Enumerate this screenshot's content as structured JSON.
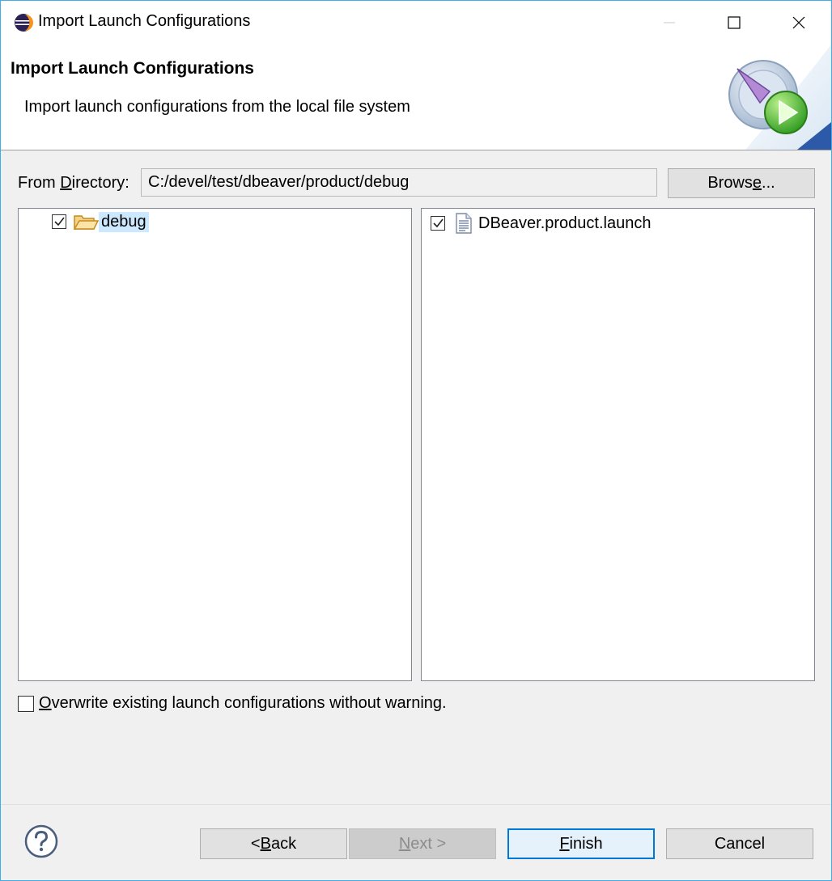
{
  "window": {
    "title": "Import Launch Configurations",
    "icon": "eclipse-icon"
  },
  "banner": {
    "title": "Import Launch Configurations",
    "description": "Import launch configurations from the local file system",
    "graphic": "wizard-launch-graphic"
  },
  "directory": {
    "label_pre": "From ",
    "label_mnemonic": "D",
    "label_post": "irectory:",
    "value": "C:/devel/test/dbeaver/product/debug",
    "browse_pre": "Brows",
    "browse_mnemonic": "e",
    "browse_post": "..."
  },
  "left_tree": {
    "items": [
      {
        "label": "debug",
        "checked": true,
        "icon": "open-folder-icon",
        "selected": true
      }
    ]
  },
  "right_list": {
    "items": [
      {
        "label": "DBeaver.product.launch",
        "checked": true,
        "icon": "launch-file-icon"
      }
    ]
  },
  "overwrite": {
    "mnemonic": "O",
    "label_rest": "verwrite existing launch configurations without warning.",
    "checked": false
  },
  "footer": {
    "back_pre": "< ",
    "back_mnemonic": "B",
    "back_post": "ack",
    "next_mnemonic": "N",
    "next_post": "ext >",
    "finish_mnemonic": "F",
    "finish_post": "inish",
    "cancel": "Cancel"
  },
  "colors": {
    "window_border": "#3daee9",
    "selection": "#cce8ff",
    "default_button_border": "#0078d7"
  }
}
